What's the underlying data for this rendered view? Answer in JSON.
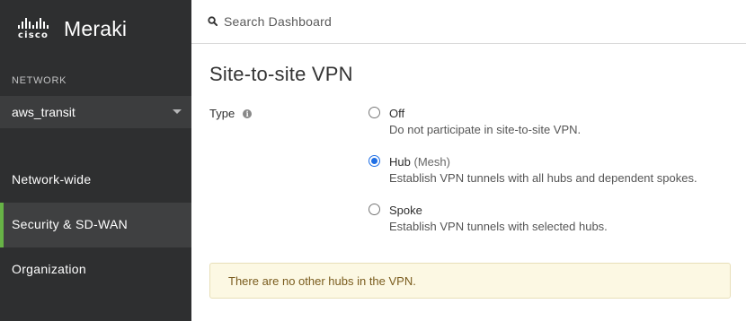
{
  "brand": {
    "company": "cisco",
    "product": "Meraki"
  },
  "sidebar": {
    "network_label": "NETWORK",
    "network_name": "aws_transit",
    "items": [
      {
        "label": "Network-wide",
        "active": false
      },
      {
        "label": "Security & SD-WAN",
        "active": true
      },
      {
        "label": "Organization",
        "active": false
      }
    ],
    "accent_color": "#67b346"
  },
  "search": {
    "placeholder": "Search Dashboard",
    "value": ""
  },
  "page": {
    "title": "Site-to-site VPN"
  },
  "type_field": {
    "label": "Type",
    "options": [
      {
        "title": "Off",
        "subtitle": "",
        "description": "Do not participate in site-to-site VPN.",
        "selected": false
      },
      {
        "title": "Hub",
        "subtitle": "(Mesh)",
        "description": "Establish VPN tunnels with all hubs and dependent spokes.",
        "selected": true
      },
      {
        "title": "Spoke",
        "subtitle": "",
        "description": "Establish VPN tunnels with selected hubs.",
        "selected": false
      }
    ]
  },
  "alert": {
    "message": "There are no other hubs in the VPN."
  },
  "icons": {
    "search": "search-icon",
    "info": "info-icon",
    "dropdown": "chevron-down-icon"
  }
}
